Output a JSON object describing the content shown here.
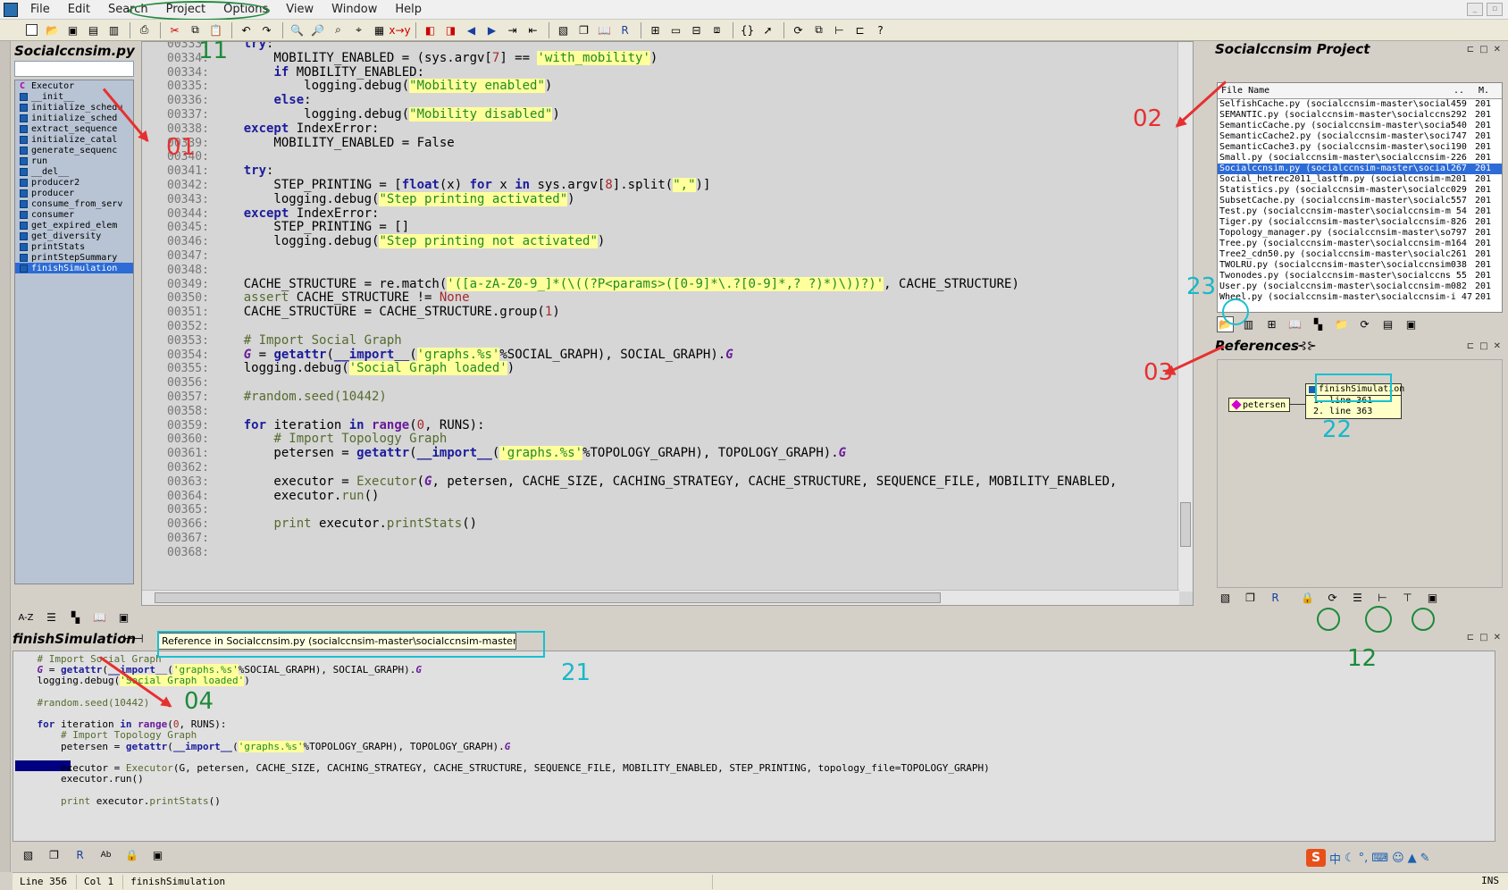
{
  "menu": [
    "File",
    "Edit",
    "Search",
    "Project",
    "Options",
    "View",
    "Window",
    "Help"
  ],
  "outline": {
    "title": "Socialccnsim.py",
    "items": [
      {
        "label": "Executor",
        "kind": "class"
      },
      {
        "label": "__init__",
        "kind": "func"
      },
      {
        "label": "initialize_schedu",
        "kind": "func"
      },
      {
        "label": "initialize_sched",
        "kind": "func"
      },
      {
        "label": "extract_sequence",
        "kind": "func"
      },
      {
        "label": "initialize_catal",
        "kind": "func"
      },
      {
        "label": "generate_sequenc",
        "kind": "func"
      },
      {
        "label": "run",
        "kind": "func"
      },
      {
        "label": "__del__",
        "kind": "func"
      },
      {
        "label": "producer2",
        "kind": "func"
      },
      {
        "label": "producer",
        "kind": "func"
      },
      {
        "label": "consume_from_serv",
        "kind": "func"
      },
      {
        "label": "consumer",
        "kind": "func"
      },
      {
        "label": "get_expired_elem",
        "kind": "func"
      },
      {
        "label": "get_diversity",
        "kind": "func"
      },
      {
        "label": "printStats",
        "kind": "func"
      },
      {
        "label": "printStepSummary",
        "kind": "func"
      },
      {
        "label": "finishSimulation",
        "kind": "func",
        "selected": true
      }
    ],
    "sort_label": "A-Z"
  },
  "editor": {
    "lines": [
      {
        "n": "00333:",
        "html": "    <span class=\"kw\">try</span>:"
      },
      {
        "n": "00334:",
        "html": "        MOBILITY_ENABLED = (sys.argv[<span class=\"nm\">7</span>] == <span class=\"st\">'with_mobility'</span>)"
      },
      {
        "n": "00334:",
        "html": "        <span class=\"kw\">if</span> MOBILITY_ENABLED:"
      },
      {
        "n": "00335:",
        "html": "            logging.debug(<span class=\"st\">\"Mobility enabled\"</span>)"
      },
      {
        "n": "00336:",
        "html": "        <span class=\"kw\">else</span>:"
      },
      {
        "n": "00337:",
        "html": "            logging.debug(<span class=\"st\">\"Mobility disabled\"</span>)"
      },
      {
        "n": "00338:",
        "html": "    <span class=\"kw\">except</span> IndexError:"
      },
      {
        "n": "00339:",
        "html": "        MOBILITY_ENABLED = False"
      },
      {
        "n": "00340:",
        "html": ""
      },
      {
        "n": "00341:",
        "html": "    <span class=\"kw\">try</span>:"
      },
      {
        "n": "00342:",
        "html": "        STEP_PRINTING = [<span class=\"kw\">float</span>(x) <span class=\"kw\">for</span> x <span class=\"kw\">in</span> sys.argv[<span class=\"nm\">8</span>].split(<span class=\"st\">\",\"</span>)]"
      },
      {
        "n": "00343:",
        "html": "        logging.debug(<span class=\"st\">\"Step printing activated\"</span>)"
      },
      {
        "n": "00344:",
        "html": "    <span class=\"kw\">except</span> IndexError:"
      },
      {
        "n": "00345:",
        "html": "        STEP_PRINTING = []"
      },
      {
        "n": "00346:",
        "html": "        logging.debug(<span class=\"st\">\"Step printing not activated\"</span>)"
      },
      {
        "n": "00347:",
        "html": ""
      },
      {
        "n": "00348:",
        "html": ""
      },
      {
        "n": "00349:",
        "html": "    CACHE_STRUCTURE = re.match(<span class=\"st\">'([a-zA-Z0-9_]*(\\((?P&lt;params&gt;([0-9]*\\.?[0-9]*,? ?)*)\\))?)'</span>, CACHE_STRUCTURE)"
      },
      {
        "n": "00350:",
        "html": "    <span class=\"cm\">assert</span> CACHE_STRUCTURE != <span class=\"nm\">None</span>"
      },
      {
        "n": "00351:",
        "html": "    CACHE_STRUCTURE = CACHE_STRUCTURE.group(<span class=\"nm\">1</span>)"
      },
      {
        "n": "00352:",
        "html": ""
      },
      {
        "n": "00353:",
        "html": "    <span class=\"cm\"># Import Social Graph</span>"
      },
      {
        "n": "00354:",
        "html": "    <span class=\"fn\"><i>G</i></span> = <span class=\"kw\">getattr</span>(<span class=\"kw\">__import__</span>(<span class=\"st\">'graphs.%s'</span>%SOCIAL_GRAPH), SOCIAL_GRAPH).<span class=\"fn\"><i>G</i></span>"
      },
      {
        "n": "00355:",
        "html": "    logging.debug(<span class=\"st\">'Social Graph loaded'</span>)"
      },
      {
        "n": "00356:",
        "html": ""
      },
      {
        "n": "00357:",
        "html": "    <span class=\"cm\">#random.seed(10442)</span>"
      },
      {
        "n": "00358:",
        "html": ""
      },
      {
        "n": "00359:",
        "html": "    <span class=\"kw\">for</span> iteration <span class=\"kw\">in</span> <span class=\"fn\">range</span>(<span class=\"nm\">0</span>, RUNS):"
      },
      {
        "n": "00360:",
        "html": "        <span class=\"cm\"># Import Topology Graph</span>"
      },
      {
        "n": "00361:",
        "html": "        petersen = <span class=\"kw\">getattr</span>(<span class=\"kw\">__import__</span>(<span class=\"st\">'graphs.%s'</span>%TOPOLOGY_GRAPH), TOPOLOGY_GRAPH).<span class=\"fn\"><i>G</i></span>"
      },
      {
        "n": "00362:",
        "html": ""
      },
      {
        "n": "00363:",
        "html": "        executor = <span class=\"cm\">Executor</span>(<span class=\"fn\"><i>G</i></span>, petersen, CACHE_SIZE, CACHING_STRATEGY, CACHE_STRUCTURE, SEQUENCE_FILE, MOBILITY_ENABLED,"
      },
      {
        "n": "00364:",
        "html": "        executor.<span class=\"cm\">run</span>()"
      },
      {
        "n": "00365:",
        "html": ""
      },
      {
        "n": "00366:",
        "html": "        <span class=\"cm\">print</span> executor.<span class=\"cm\">printStats</span>()"
      },
      {
        "n": "00367:",
        "html": ""
      },
      {
        "n": "00368:",
        "html": ""
      }
    ]
  },
  "project": {
    "title": "Socialccnsim Project",
    "col_name": "File Name",
    "col_dots": "..",
    "col_m": "M.",
    "rows": [
      {
        "name": "SelfishCache.py (socialccnsim-master\\social459",
        "m": "201"
      },
      {
        "name": "SEMANTIC.py (socialccnsim-master\\socialccns292",
        "m": "201"
      },
      {
        "name": "SemanticCache.py (socialccnsim-master\\socia540",
        "m": "201"
      },
      {
        "name": "SemanticCache2.py (socialccnsim-master\\soci747",
        "m": "201"
      },
      {
        "name": "SemanticCache3.py (socialccnsim-master\\soci190",
        "m": "201"
      },
      {
        "name": "Small.py (socialccnsim-master\\socialccnsim-226",
        "m": "201"
      },
      {
        "name": "Socialccnsim.py (socialccnsim-master\\social267",
        "m": "201",
        "selected": true
      },
      {
        "name": "Social_hetrec2011_lastfm.py (socialccnsim-m201",
        "m": "201"
      },
      {
        "name": "Statistics.py (socialccnsim-master\\socialcc029",
        "m": "201"
      },
      {
        "name": "SubsetCache.py (socialccnsim-master\\socialc557",
        "m": "201"
      },
      {
        "name": "Test.py (socialccnsim-master\\socialccnsim-m 54",
        "m": "201"
      },
      {
        "name": "Tiger.py (socialccnsim-master\\socialccnsim-826",
        "m": "201"
      },
      {
        "name": "Topology_manager.py (socialccnsim-master\\so797",
        "m": "201"
      },
      {
        "name": "Tree.py (socialccnsim-master\\socialccnsim-m164",
        "m": "201"
      },
      {
        "name": "Tree2_cdn50.py (socialccnsim-master\\socialc261",
        "m": "201"
      },
      {
        "name": "TWOLRU.py (socialccnsim-master\\socialccnsim038",
        "m": "201"
      },
      {
        "name": "Twonodes.py (socialccnsim-master\\socialccns 55",
        "m": "201"
      },
      {
        "name": "User.py (socialccnsim-master\\socialccnsim-m082",
        "m": "201"
      },
      {
        "name": "Wheel.py (socialccnsim-master\\socialccnsim-i 47",
        "m": "201"
      }
    ]
  },
  "references": {
    "title": "References",
    "caller": "petersen",
    "target": "finishSimulation",
    "lines": [
      "1. line 361",
      "2. line 363"
    ]
  },
  "bottom": {
    "title": "finishSimulation",
    "tooltip": "Reference in Socialccnsim.py (socialccnsim-master\\socialccnsim-master) at line 361",
    "lines": [
      "    <span class=\"cm\"># Import Social Graph</span>",
      "    <span class=\"fn\"><i>G</i></span> = <span class=\"kw\">getattr</span>(<span class=\"kw\">__import__</span>(<span class=\"st\">'graphs.%s'</span>%SOCIAL_GRAPH), SOCIAL_GRAPH).<span class=\"fn\"><i>G</i></span>",
      "    logging.debug(<span class=\"st\">'Social Graph loaded'</span>)",
      "",
      "    <span class=\"cm\">#random.seed(10442)</span>",
      "",
      "    <span class=\"kw\">for</span> iteration <span class=\"kw\">in</span> <span class=\"fn\">range</span>(<span class=\"nm\">0</span>, RUNS):",
      "        <span class=\"cm\"># Import Topology Graph</span>",
      "        petersen = <span class=\"kw\">getattr</span>(<span class=\"kw\">__import__</span>(<span class=\"st\">'graphs.%s'</span>%TOPOLOGY_GRAPH), TOPOLOGY_GRAPH).<span class=\"fn\"><i>G</i></span>",
      "",
      "        executor = <span class=\"cm\">Executor</span>(G, petersen, CACHE_SIZE, CACHING_STRATEGY, CACHE_STRUCTURE, SEQUENCE_FILE, MOBILITY_ENABLED, STEP_PRINTING, topology_file=TOPOLOGY_GRAPH)",
      "        executor.run()",
      "",
      "        <span class=\"cm\">print</span> executor.<span class=\"cm\">printStats</span>()"
    ]
  },
  "status": {
    "line": "Line 356",
    "col": "Col 1",
    "scope": "finishSimulation",
    "mode": "INS"
  },
  "ime": {
    "logo": "S",
    "lang": "中"
  },
  "annotations": {
    "n01": "01",
    "n02": "02",
    "n03": "03",
    "n04": "04",
    "n11": "11",
    "n12": "12",
    "n21": "21",
    "n22": "22",
    "n23": "23"
  },
  "colors": {
    "accent_red": "#e63030",
    "accent_green": "#1e8a3a",
    "accent_cyan": "#18b8c8",
    "selection": "#2d6bd6"
  }
}
